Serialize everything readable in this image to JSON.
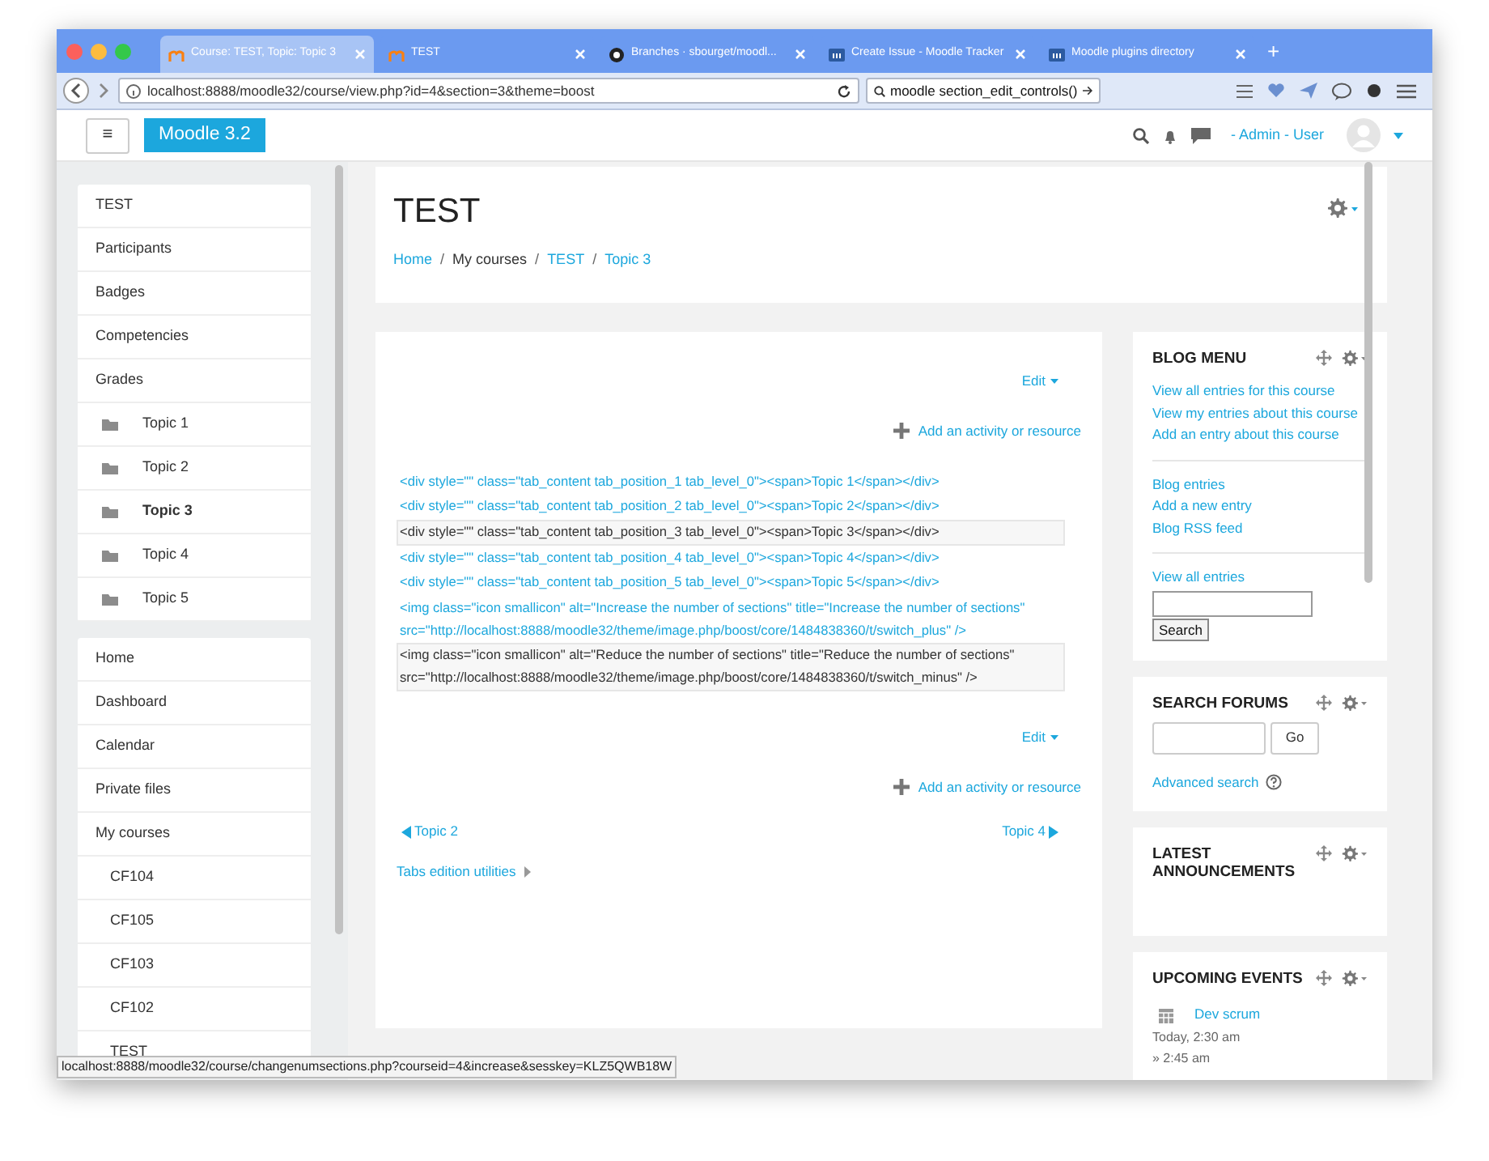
{
  "browser": {
    "tabs": [
      {
        "title": "Course: TEST, Topic: Topic 3",
        "kind": "moodle",
        "selected": true
      },
      {
        "title": "TEST",
        "kind": "moodle",
        "selected": false
      },
      {
        "title": "Branches · sbourget/moodl...",
        "kind": "github",
        "selected": false
      },
      {
        "title": "Create Issue - Moodle Tracker",
        "kind": "tracker",
        "selected": false
      },
      {
        "title": "Moodle plugins directory",
        "kind": "tracker",
        "selected": false
      }
    ],
    "new_tab": "+",
    "url": "localhost:8888/moodle32/course/view.php?id=4&section=3&theme=boost",
    "search": "moodle section_edit_controls()",
    "status_url": "localhost:8888/moodle32/course/changenumsections.php?courseid=4&increase&sesskey=KLZ5QWB18W"
  },
  "navbar": {
    "menu": "≡",
    "brand": "Moodle 3.2",
    "user": "- Admin - User"
  },
  "drawer": {
    "groups": [
      [
        {
          "label": "TEST",
          "kind": "link",
          "selected": false
        },
        {
          "label": "Participants",
          "kind": "link",
          "selected": false
        },
        {
          "label": "Badges",
          "kind": "link",
          "selected": false
        },
        {
          "label": "Competencies",
          "kind": "link",
          "selected": false
        },
        {
          "label": "Grades",
          "kind": "link",
          "selected": false
        },
        {
          "label": "Topic 1",
          "kind": "section",
          "selected": false
        },
        {
          "label": "Topic 2",
          "kind": "section",
          "selected": false
        },
        {
          "label": "Topic 3",
          "kind": "section",
          "selected": true
        },
        {
          "label": "Topic 4",
          "kind": "section",
          "selected": false
        },
        {
          "label": "Topic 5",
          "kind": "section",
          "selected": false
        }
      ],
      [
        {
          "label": "Home",
          "kind": "link",
          "selected": false
        },
        {
          "label": "Dashboard",
          "kind": "link",
          "selected": false
        },
        {
          "label": "Calendar",
          "kind": "link",
          "selected": false
        },
        {
          "label": "Private files",
          "kind": "link",
          "selected": false
        },
        {
          "label": "My courses",
          "kind": "link",
          "selected": false,
          "children": [
            {
              "label": "CF104",
              "kind": "course",
              "selected": false
            },
            {
              "label": "CF105",
              "kind": "course",
              "selected": false
            },
            {
              "label": "CF103",
              "kind": "course",
              "selected": false
            },
            {
              "label": "CF102",
              "kind": "course",
              "selected": false
            },
            {
              "label": "TEST",
              "kind": "course",
              "selected": false
            }
          ]
        }
      ]
    ]
  },
  "header": {
    "title": "TEST",
    "separator": "/",
    "breadcrumb": [
      {
        "label": "Home",
        "link": true
      },
      {
        "label": "My courses",
        "link": false
      },
      {
        "label": "TEST",
        "link": true
      },
      {
        "label": "Topic 3",
        "link": true
      }
    ]
  },
  "section": {
    "edit": "Edit",
    "add": "Add an activity or resource",
    "lines": [
      {
        "text": "<div style=\"\" class=\"tab_content tab_position_1 tab_level_0\"><span>Topic 1</span></div>",
        "highlighted": false
      },
      {
        "text": "<div style=\"\" class=\"tab_content tab_position_2 tab_level_0\"><span>Topic 2</span></div>",
        "highlighted": false
      },
      {
        "text": "<div style=\"\" class=\"tab_content tab_position_3 tab_level_0\"><span>Topic 3</span></div>",
        "highlighted": true
      },
      {
        "text": "<div style=\"\" class=\"tab_content tab_position_4 tab_level_0\"><span>Topic 4</span></div>",
        "highlighted": false
      },
      {
        "text": "<div style=\"\" class=\"tab_content tab_position_5 tab_level_0\"><span>Topic 5</span></div>",
        "highlighted": false
      },
      {
        "text": "<img class=\"icon smallicon\" alt=\"Increase the number of sections\" title=\"Increase the number of sections\" src=\"http://localhost:8888/moodle32/theme/image.php/boost/core/1484838360/t/switch_plus\" />",
        "highlighted": false
      },
      {
        "text": "<img class=\"icon smallicon\" alt=\"Reduce the number of sections\" title=\"Reduce the number of sections\" src=\"http://localhost:8888/moodle32/theme/image.php/boost/core/1484838360/t/switch_minus\" />",
        "highlighted": true
      }
    ],
    "edit_2": "Edit",
    "add_2": "Add an activity or resource",
    "prev": "Topic 2",
    "next": "Topic 4",
    "utilities": "Tabs edition utilities"
  },
  "blocks": [
    {
      "title": "BLOG MENU",
      "kind": "blog",
      "groups": [
        [
          "View all entries for this course",
          "View my entries about this course",
          "Add an entry about this course"
        ],
        [
          "Blog entries",
          "Add a new entry",
          "Blog RSS feed"
        ],
        [
          "View all entries"
        ]
      ],
      "button": "Search"
    },
    {
      "title": "SEARCH FORUMS",
      "kind": "search",
      "button": "Go",
      "link": "Advanced search"
    },
    {
      "title": "LATEST ANNOUNCEMENTS",
      "kind": "empty"
    },
    {
      "title": "UPCOMING EVENTS",
      "kind": "events",
      "events": [
        {
          "name": "Dev scrum",
          "time": "Today, 2:30 am",
          "end": "» 2:45 am"
        }
      ]
    }
  ]
}
